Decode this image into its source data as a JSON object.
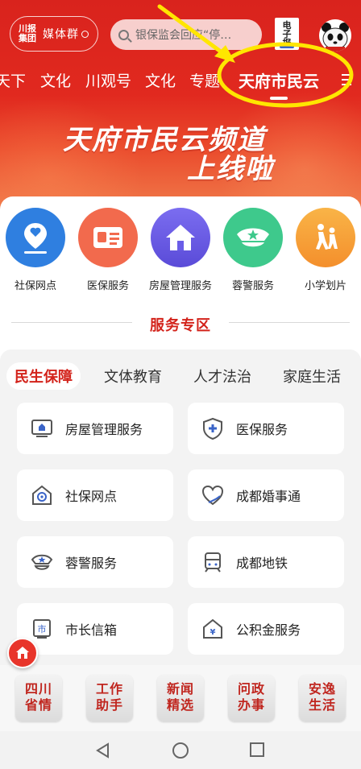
{
  "header": {
    "brand_line1": "川报",
    "brand_line2": "集团",
    "media_group": "媒体群",
    "search_placeholder": "银保监会回应“停…",
    "epaper_label": "电子报"
  },
  "tabs": [
    {
      "label": "天下"
    },
    {
      "label": "文化"
    },
    {
      "label": "川观号"
    },
    {
      "label": "文化"
    },
    {
      "label": "专题"
    },
    {
      "label": "天府市民云",
      "active": true
    }
  ],
  "banner": {
    "line1": "天府市民云频道",
    "line2": "上线啦"
  },
  "quick_services": [
    {
      "label": "社保网点",
      "color": "#2f7fe0",
      "icon": "location-pin-icon"
    },
    {
      "label": "医保服务",
      "color": "#f26a4d",
      "icon": "id-card-icon"
    },
    {
      "label": "房屋管理服务",
      "color": "#6a5de8",
      "icon": "house-icon"
    },
    {
      "label": "蓉警服务",
      "color": "#3ec98c",
      "icon": "police-cap-icon"
    },
    {
      "label": "小学划片",
      "color": "#f7a43a",
      "icon": "walking-kids-icon"
    }
  ],
  "section_title": "服务专区",
  "zone_tabs": [
    {
      "label": "民生保障",
      "active": true
    },
    {
      "label": "文体教育"
    },
    {
      "label": "人才法治"
    },
    {
      "label": "家庭生活"
    }
  ],
  "service_tiles": [
    {
      "label": "房屋管理服务",
      "icon": "monitor-house-icon"
    },
    {
      "label": "医保服务",
      "icon": "shield-plus-icon"
    },
    {
      "label": "社保网点",
      "icon": "home-location-icon"
    },
    {
      "label": "成都婚事通",
      "icon": "heart-icon"
    },
    {
      "label": "蓉警服务",
      "icon": "police-cap-icon"
    },
    {
      "label": "成都地铁",
      "icon": "metro-train-icon"
    },
    {
      "label": "市长信箱",
      "icon": "mailbox-icon"
    },
    {
      "label": "公积金服务",
      "icon": "yuan-house-icon"
    }
  ],
  "dock": [
    {
      "line1": "四川",
      "line2": "省情"
    },
    {
      "line1": "工作",
      "line2": "助手"
    },
    {
      "line1": "新闻",
      "line2": "精选"
    },
    {
      "line1": "问政",
      "line2": "办事"
    },
    {
      "line1": "安逸",
      "line2": "生活"
    }
  ],
  "colors": {
    "brand_red": "#d3231b",
    "annotation_yellow": "#ffe600"
  }
}
